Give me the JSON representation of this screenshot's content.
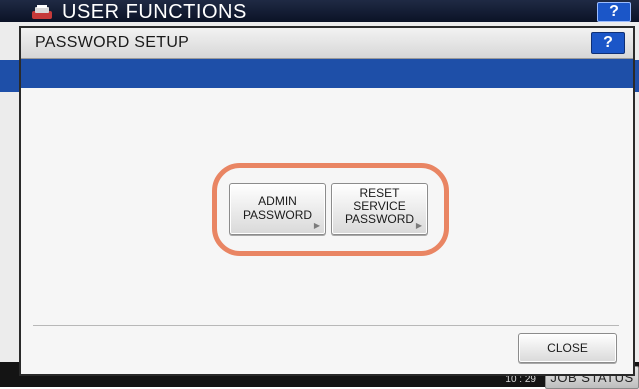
{
  "background": {
    "title": "USER FUNCTIONS",
    "help_label": "?",
    "job_status_label": "JOB STATUS",
    "time": "10 : 29"
  },
  "dialog": {
    "title": "PASSWORD SETUP",
    "help_label": "?",
    "buttons": {
      "admin_password": {
        "line1": "ADMIN",
        "line2": "PASSWORD"
      },
      "reset_service_password": {
        "line1": "RESET",
        "line2": "SERVICE",
        "line3": "PASSWORD"
      }
    },
    "close_label": "CLOSE"
  },
  "colors": {
    "accent_blue": "#1e4fa8",
    "help_blue": "#1b56c8",
    "highlight_orange": "#e98563"
  },
  "icons": {
    "admin_arrow": "right-arrow-icon",
    "reset_arrow": "right-arrow-icon"
  }
}
